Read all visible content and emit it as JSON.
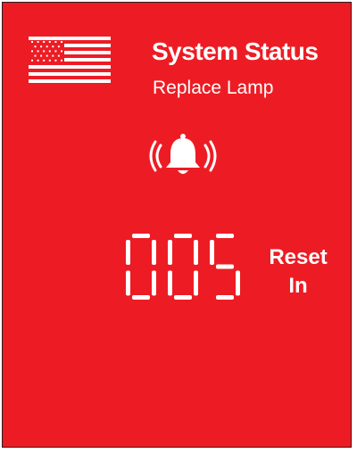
{
  "status": {
    "title": "System Status",
    "message": "Replace Lamp"
  },
  "counter": {
    "value": "005"
  },
  "reset": {
    "line1": "Reset",
    "line2": "In"
  },
  "icons": {
    "flag": "us-flag-icon",
    "alarm": "ringing-bell-icon"
  },
  "colors": {
    "panel_background": "#ed1c24",
    "foreground": "#ffffff",
    "border": "#231f20"
  }
}
